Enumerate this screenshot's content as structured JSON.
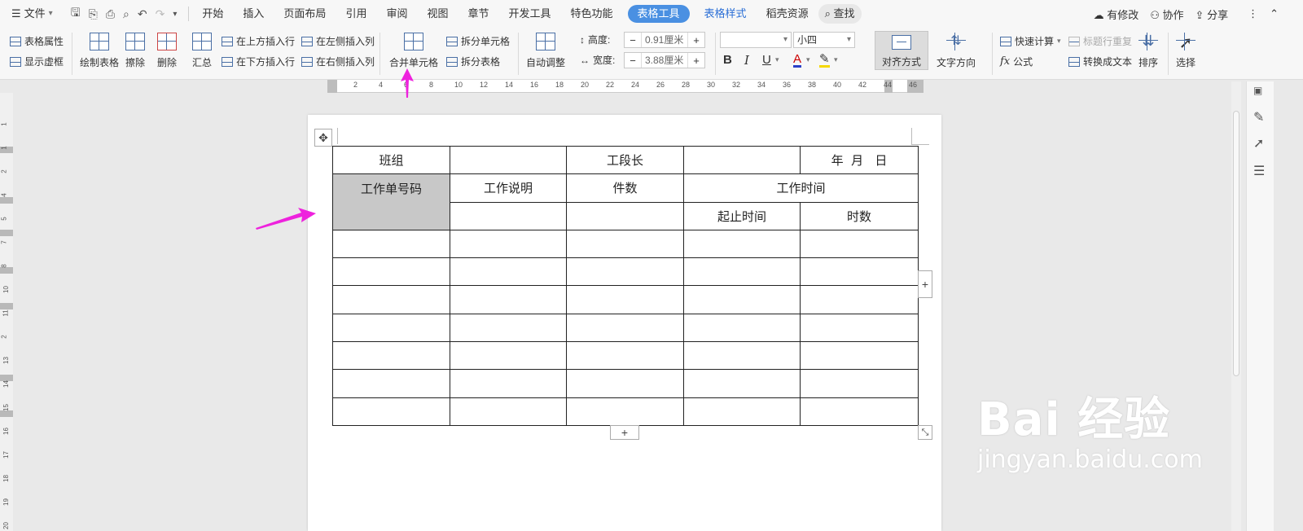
{
  "menubar": {
    "file_label": "文件",
    "tabs": [
      {
        "label": "开始"
      },
      {
        "label": "插入"
      },
      {
        "label": "页面布局"
      },
      {
        "label": "引用"
      },
      {
        "label": "审阅"
      },
      {
        "label": "视图"
      },
      {
        "label": "章节"
      },
      {
        "label": "开发工具"
      },
      {
        "label": "特色功能"
      }
    ],
    "active_tab": "表格工具",
    "tab_style": "表格样式",
    "tab_resources": "稻壳资源",
    "search_label": "查找",
    "right": {
      "changes": "有修改",
      "collab": "协作",
      "share": "分享"
    }
  },
  "ribbon": {
    "table_props": "表格属性",
    "show_grid": "显示虚框",
    "draw_table": "绘制表格",
    "erase": "擦除",
    "delete": "删除",
    "summary": "汇总",
    "insert_above": "在上方插入行",
    "insert_below": "在下方插入行",
    "insert_left": "在左侧插入列",
    "insert_right": "在右侧插入列",
    "merge_cells": "合并单元格",
    "split_cells": "拆分单元格",
    "split_table": "拆分表格",
    "auto_fit": "自动调整",
    "height_label": "高度:",
    "height_value": "0.91厘米",
    "width_label": "宽度:",
    "width_value": "3.88厘米",
    "font_name": "",
    "font_size": "小四",
    "align": "对齐方式",
    "text_dir": "文字方向",
    "quick_calc": "快速计算",
    "repeat_header": "标题行重复",
    "formula": "公式",
    "to_text": "转换成文本",
    "sort": "排序",
    "select": "选择"
  },
  "ruler": [
    "2",
    "4",
    "6",
    "8",
    "10",
    "12",
    "14",
    "16",
    "18",
    "20",
    "22",
    "24",
    "26",
    "28",
    "30",
    "32",
    "34",
    "36",
    "38",
    "40",
    "42",
    "44",
    "46"
  ],
  "vruler": [
    "1",
    "1",
    "2",
    "4",
    "5",
    "7",
    "8",
    "10",
    "11",
    "2",
    "13",
    "14",
    "15",
    "16",
    "17",
    "18",
    "19",
    "20"
  ],
  "table": {
    "rows": [
      [
        "班组",
        "",
        "工段长",
        "",
        "年  月   日"
      ],
      [
        "工作单号码",
        "工作说明",
        "件数",
        "工作时间"
      ],
      [
        "",
        "",
        "",
        "起止时间",
        "时数"
      ]
    ],
    "empty_rows": 7
  },
  "watermark": {
    "big": "Bai 经验",
    "small": "jingyan.baidu.com"
  },
  "colors": {
    "accent": "#4a90e2",
    "arrow": "#ee22dd",
    "selected_cell": "#c8c8c8"
  }
}
